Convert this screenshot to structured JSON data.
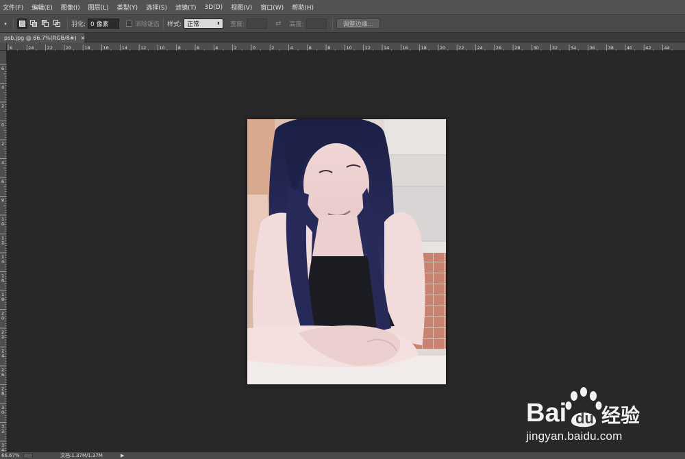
{
  "menu": [
    "文件(F)",
    "编辑(E)",
    "图像(I)",
    "图层(L)",
    "类型(Y)",
    "选择(S)",
    "滤镜(T)",
    "3D(D)",
    "视图(V)",
    "窗口(W)",
    "帮助(H)"
  ],
  "options": {
    "feather_label": "羽化:",
    "feather_value": "0 像素",
    "antialias_label": "消除锯齿",
    "style_label": "样式:",
    "style_value": "正常",
    "width_label": "宽度:",
    "height_label": "高度:",
    "refine_button": "调整边缘..."
  },
  "document": {
    "tab_title": "psb.jpg @ 66.7%(RGB/8#)",
    "close_glyph": "×"
  },
  "rulers": {
    "top_labels": [
      "6",
      "24",
      "22",
      "20",
      "18",
      "16",
      "14",
      "12",
      "10",
      "8",
      "6",
      "4",
      "2",
      "0",
      "2",
      "4",
      "6",
      "8",
      "10",
      "12",
      "14",
      "16",
      "18",
      "20",
      "22",
      "24",
      "26",
      "28",
      "30",
      "32",
      "34",
      "36",
      "38",
      "40",
      "42",
      "44"
    ],
    "left_labels": [
      "6",
      "4",
      "2",
      "0",
      "2",
      "4",
      "6",
      "8",
      "10",
      "12",
      "14",
      "16",
      "18",
      "20",
      "22",
      "24",
      "26",
      "28",
      "30",
      "32",
      "34"
    ]
  },
  "status": {
    "zoom": "66.67%",
    "doc_info": "文档:1.37M/1.37M",
    "arrow": "▶"
  },
  "watermark": {
    "brand_text": "Bai",
    "brand_text2": "du",
    "brand_cn": "经验",
    "url": "jingyan.baidu.com"
  },
  "colors": {
    "menubar": "#535353",
    "optionsbar": "#4a4a4a",
    "workspace": "#282828",
    "ruler": "#4d4d4d"
  }
}
